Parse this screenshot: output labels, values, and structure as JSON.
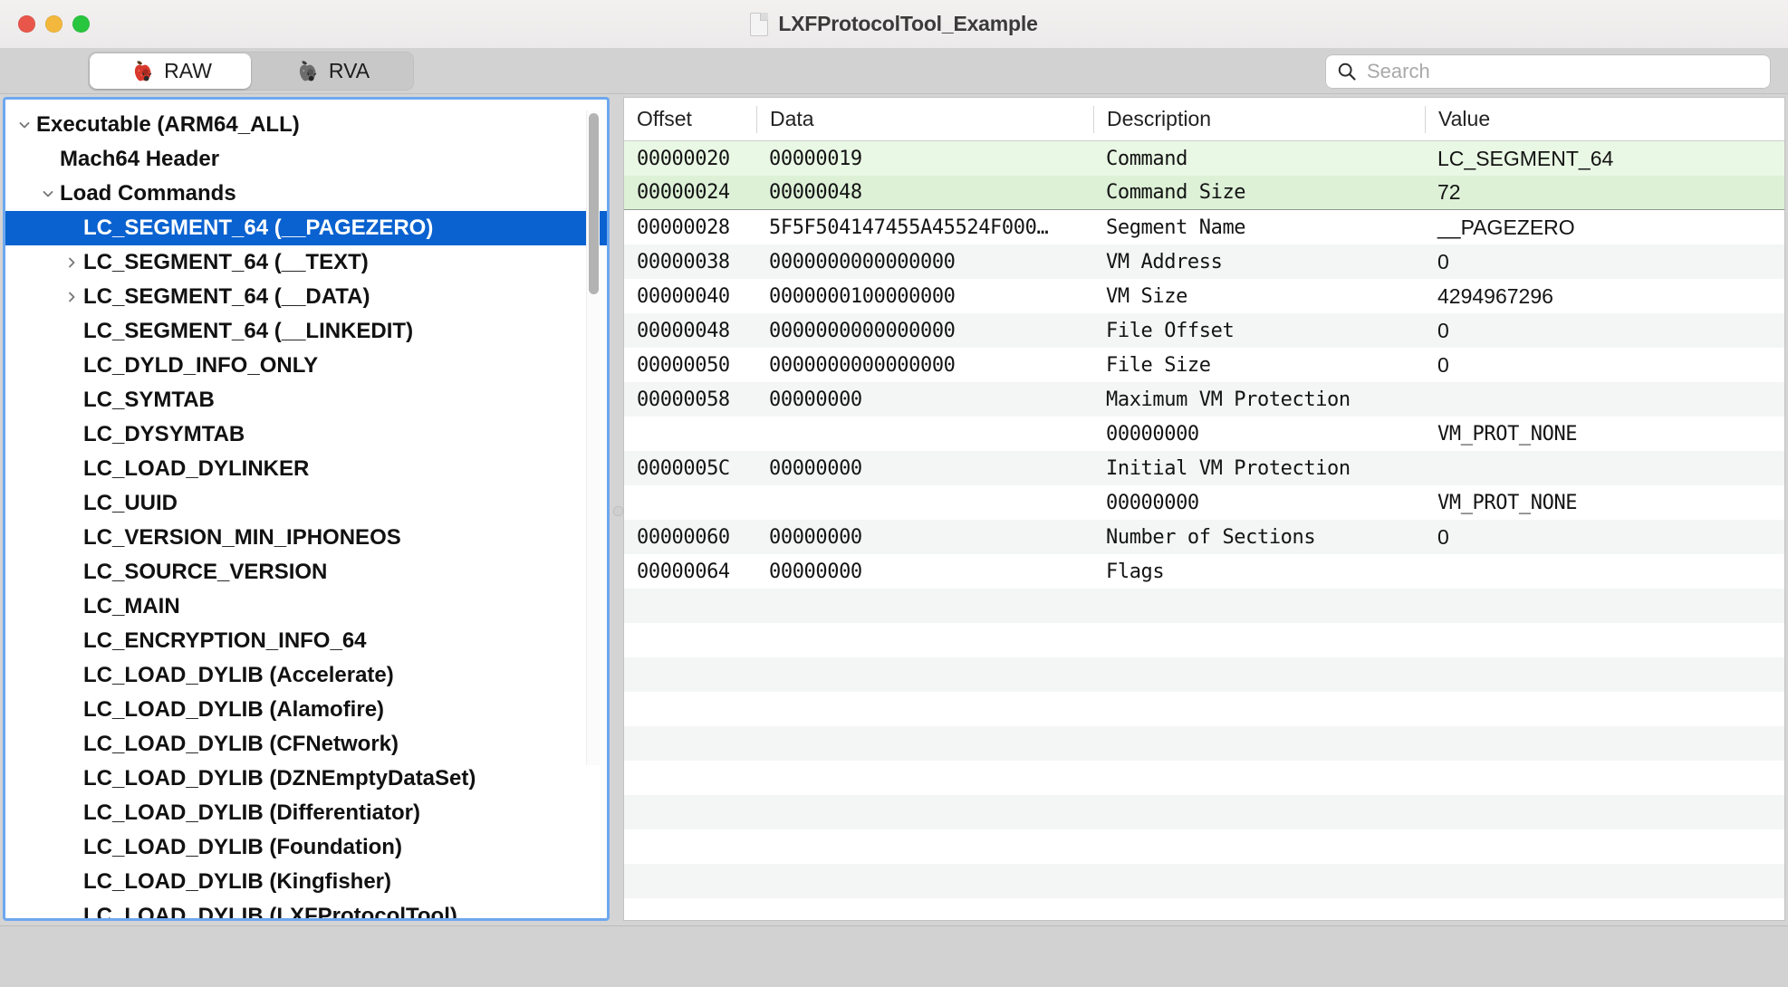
{
  "window": {
    "title": "LXFProtocolTool_Example",
    "doc_icon": "document-icon",
    "traffic_lights": [
      {
        "name": "close",
        "color": "#e8564a"
      },
      {
        "name": "minimize",
        "color": "#f2b73c"
      },
      {
        "name": "zoom",
        "color": "#28c53e"
      }
    ]
  },
  "toolbar": {
    "segments": [
      {
        "label": "RAW",
        "icon": "red-apple-icon",
        "selected": true
      },
      {
        "label": "RVA",
        "icon": "gray-apple-icon",
        "selected": false
      }
    ],
    "search": {
      "icon": "search-icon",
      "placeholder": "Search",
      "value": ""
    }
  },
  "sidebar": {
    "items": [
      {
        "label": "Executable  (ARM64_ALL)",
        "indent": 0,
        "twisty": "down",
        "bold": true,
        "selected": false
      },
      {
        "label": "Mach64 Header",
        "indent": 1,
        "twisty": "none",
        "bold": true,
        "selected": false
      },
      {
        "label": "Load Commands",
        "indent": 1,
        "twisty": "down",
        "bold": true,
        "selected": false
      },
      {
        "label": "LC_SEGMENT_64 (__PAGEZERO)",
        "indent": 2,
        "twisty": "none",
        "bold": true,
        "selected": true
      },
      {
        "label": "LC_SEGMENT_64 (__TEXT)",
        "indent": 2,
        "twisty": "right",
        "bold": true,
        "selected": false
      },
      {
        "label": "LC_SEGMENT_64 (__DATA)",
        "indent": 2,
        "twisty": "right",
        "bold": true,
        "selected": false
      },
      {
        "label": "LC_SEGMENT_64 (__LINKEDIT)",
        "indent": 2,
        "twisty": "none",
        "bold": true,
        "selected": false
      },
      {
        "label": "LC_DYLD_INFO_ONLY",
        "indent": 2,
        "twisty": "none",
        "bold": true,
        "selected": false
      },
      {
        "label": "LC_SYMTAB",
        "indent": 2,
        "twisty": "none",
        "bold": true,
        "selected": false
      },
      {
        "label": "LC_DYSYMTAB",
        "indent": 2,
        "twisty": "none",
        "bold": true,
        "selected": false
      },
      {
        "label": "LC_LOAD_DYLINKER",
        "indent": 2,
        "twisty": "none",
        "bold": true,
        "selected": false
      },
      {
        "label": "LC_UUID",
        "indent": 2,
        "twisty": "none",
        "bold": true,
        "selected": false
      },
      {
        "label": "LC_VERSION_MIN_IPHONEOS",
        "indent": 2,
        "twisty": "none",
        "bold": true,
        "selected": false
      },
      {
        "label": "LC_SOURCE_VERSION",
        "indent": 2,
        "twisty": "none",
        "bold": true,
        "selected": false
      },
      {
        "label": "LC_MAIN",
        "indent": 2,
        "twisty": "none",
        "bold": true,
        "selected": false
      },
      {
        "label": "LC_ENCRYPTION_INFO_64",
        "indent": 2,
        "twisty": "none",
        "bold": true,
        "selected": false
      },
      {
        "label": "LC_LOAD_DYLIB (Accelerate)",
        "indent": 2,
        "twisty": "none",
        "bold": true,
        "selected": false
      },
      {
        "label": "LC_LOAD_DYLIB (Alamofire)",
        "indent": 2,
        "twisty": "none",
        "bold": true,
        "selected": false
      },
      {
        "label": "LC_LOAD_DYLIB (CFNetwork)",
        "indent": 2,
        "twisty": "none",
        "bold": true,
        "selected": false
      },
      {
        "label": "LC_LOAD_DYLIB (DZNEmptyDataSet)",
        "indent": 2,
        "twisty": "none",
        "bold": true,
        "selected": false
      },
      {
        "label": "LC_LOAD_DYLIB (Differentiator)",
        "indent": 2,
        "twisty": "none",
        "bold": true,
        "selected": false
      },
      {
        "label": "LC_LOAD_DYLIB (Foundation)",
        "indent": 2,
        "twisty": "none",
        "bold": true,
        "selected": false
      },
      {
        "label": "LC_LOAD_DYLIB (Kingfisher)",
        "indent": 2,
        "twisty": "none",
        "bold": true,
        "selected": false
      },
      {
        "label": "LC_LOAD_DYLIB (LXFProtocolTool)",
        "indent": 2,
        "twisty": "none",
        "bold": true,
        "selected": false
      }
    ],
    "scrollbar": {
      "name": "sidebar-scrollbar"
    }
  },
  "table": {
    "columns": [
      "Offset",
      "Data",
      "Description",
      "Value"
    ],
    "rows": [
      {
        "offset": "00000020",
        "data": "00000019",
        "description": "Command",
        "value": "LC_SEGMENT_64",
        "style": "hl-a",
        "value_mono": false
      },
      {
        "offset": "00000024",
        "data": "00000048",
        "description": "Command Size",
        "value": "72",
        "style": "hl-b",
        "value_mono": false
      },
      {
        "offset": "00000028",
        "data": "5F5F504147455A45524F000…",
        "description": "Segment Name",
        "value": "__PAGEZERO",
        "style": "even",
        "value_mono": false
      },
      {
        "offset": "00000038",
        "data": "0000000000000000",
        "description": "VM Address",
        "value": "0",
        "style": "odd",
        "value_mono": false
      },
      {
        "offset": "00000040",
        "data": "0000000100000000",
        "description": "VM Size",
        "value": "4294967296",
        "style": "even",
        "value_mono": false
      },
      {
        "offset": "00000048",
        "data": "0000000000000000",
        "description": "File Offset",
        "value": "0",
        "style": "odd",
        "value_mono": false
      },
      {
        "offset": "00000050",
        "data": "0000000000000000",
        "description": "File Size",
        "value": "0",
        "style": "even",
        "value_mono": false
      },
      {
        "offset": "00000058",
        "data": "00000000",
        "description": "Maximum VM Protection",
        "value": "",
        "style": "odd",
        "value_mono": false
      },
      {
        "offset": "",
        "data": "",
        "description": "00000000",
        "value": "VM_PROT_NONE",
        "style": "even",
        "value_mono": true
      },
      {
        "offset": "0000005C",
        "data": "00000000",
        "description": "Initial VM Protection",
        "value": "",
        "style": "odd",
        "value_mono": false
      },
      {
        "offset": "",
        "data": "",
        "description": "00000000",
        "value": "VM_PROT_NONE",
        "style": "even",
        "value_mono": true
      },
      {
        "offset": "00000060",
        "data": "00000000",
        "description": "Number of Sections",
        "value": "0",
        "style": "odd",
        "value_mono": false
      },
      {
        "offset": "00000064",
        "data": "00000000",
        "description": "Flags",
        "value": "",
        "style": "even",
        "value_mono": false
      },
      {
        "offset": "",
        "data": "",
        "description": "",
        "value": "",
        "style": "odd",
        "value_mono": false
      },
      {
        "offset": "",
        "data": "",
        "description": "",
        "value": "",
        "style": "even",
        "value_mono": false
      },
      {
        "offset": "",
        "data": "",
        "description": "",
        "value": "",
        "style": "odd",
        "value_mono": false
      },
      {
        "offset": "",
        "data": "",
        "description": "",
        "value": "",
        "style": "even",
        "value_mono": false
      },
      {
        "offset": "",
        "data": "",
        "description": "",
        "value": "",
        "style": "odd",
        "value_mono": false
      },
      {
        "offset": "",
        "data": "",
        "description": "",
        "value": "",
        "style": "even",
        "value_mono": false
      },
      {
        "offset": "",
        "data": "",
        "description": "",
        "value": "",
        "style": "odd",
        "value_mono": false
      },
      {
        "offset": "",
        "data": "",
        "description": "",
        "value": "",
        "style": "even",
        "value_mono": false
      },
      {
        "offset": "",
        "data": "",
        "description": "",
        "value": "",
        "style": "odd",
        "value_mono": false
      },
      {
        "offset": "",
        "data": "",
        "description": "",
        "value": "",
        "style": "even",
        "value_mono": false
      }
    ]
  }
}
